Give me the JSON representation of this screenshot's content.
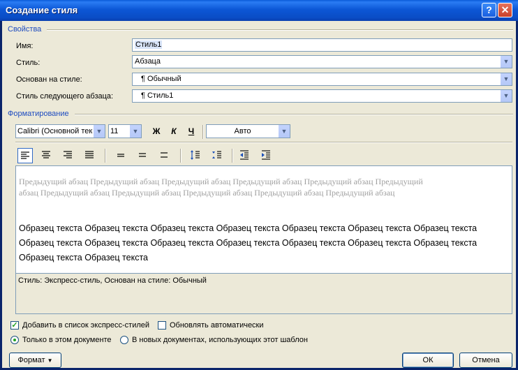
{
  "window": {
    "title": "Создание стиля",
    "help_glyph": "?",
    "close_glyph": "✕"
  },
  "properties": {
    "section_title": "Свойства",
    "name_label": "Имя:",
    "name_value": "Стиль1",
    "style_type_label": "Стиль:",
    "style_type_value": "Абзаца",
    "based_on_label": "Основан на стиле:",
    "based_on_value": "¶ Обычный",
    "next_style_label": "Стиль следующего абзаца:",
    "next_style_value": "¶ Стиль1"
  },
  "formatting": {
    "section_title": "Форматирование",
    "font": "Calibri (Основной текс",
    "size": "11",
    "bold": "Ж",
    "italic": "К",
    "underline": "Ч",
    "color": "Авто"
  },
  "preview": {
    "previous_paragraph": "Предыдущий абзац Предыдущий абзац Предыдущий абзац Предыдущий абзац Предыдущий абзац Предыдущий абзац Предыдущий абзац Предыдущий абзац Предыдущий абзац Предыдущий абзац Предыдущий абзац",
    "sample_text": "Образец текста Образец текста Образец текста Образец текста Образец текста Образец текста Образец текста Образец текста Образец текста Образец текста Образец текста Образец текста Образец текста Образец текста Образец текста Образец текста"
  },
  "description": "Стиль: Экспресс-стиль, Основан на стиле: Обычный",
  "options": {
    "add_to_quick_styles": "Добавить в список экспресс-стилей",
    "add_to_quick_styles_checked": true,
    "auto_update": "Обновлять автоматически",
    "auto_update_checked": false,
    "only_this_document": "Только в этом документе",
    "new_documents": "В новых документах, использующих этот шаблон",
    "selected_scope": "only_this_document"
  },
  "buttons": {
    "format": "Формат",
    "ok": "ОК",
    "cancel": "Отмена"
  },
  "colors": {
    "title_bar": "#0a5bd8",
    "section_title": "#1e4cc0",
    "preview_grey": "#a0a0a0",
    "dialog_bg": "#ece9d8"
  }
}
